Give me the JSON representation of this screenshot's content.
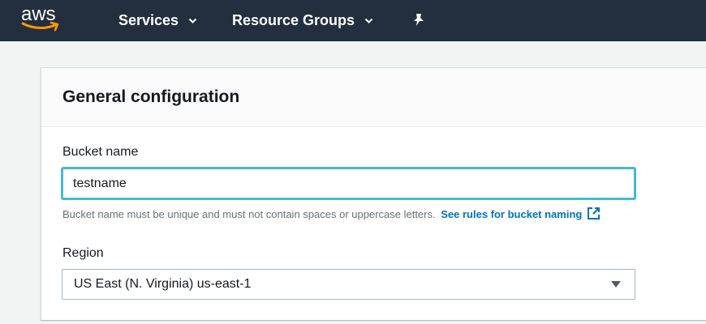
{
  "topnav": {
    "logo_text": "aws",
    "services_label": "Services",
    "resource_groups_label": "Resource Groups"
  },
  "card": {
    "title": "General configuration",
    "bucket_name": {
      "label": "Bucket name",
      "value": "testname",
      "hint": "Bucket name must be unique and must not contain spaces or uppercase letters.",
      "hint_link": "See rules for bucket naming"
    },
    "region": {
      "label": "Region",
      "selected": "US East (N. Virginia) us-east-1"
    }
  },
  "colors": {
    "nav_bg": "#232f3e",
    "focus": "#44b9d6",
    "link": "#0073bb",
    "logo_accent": "#ff9900"
  }
}
